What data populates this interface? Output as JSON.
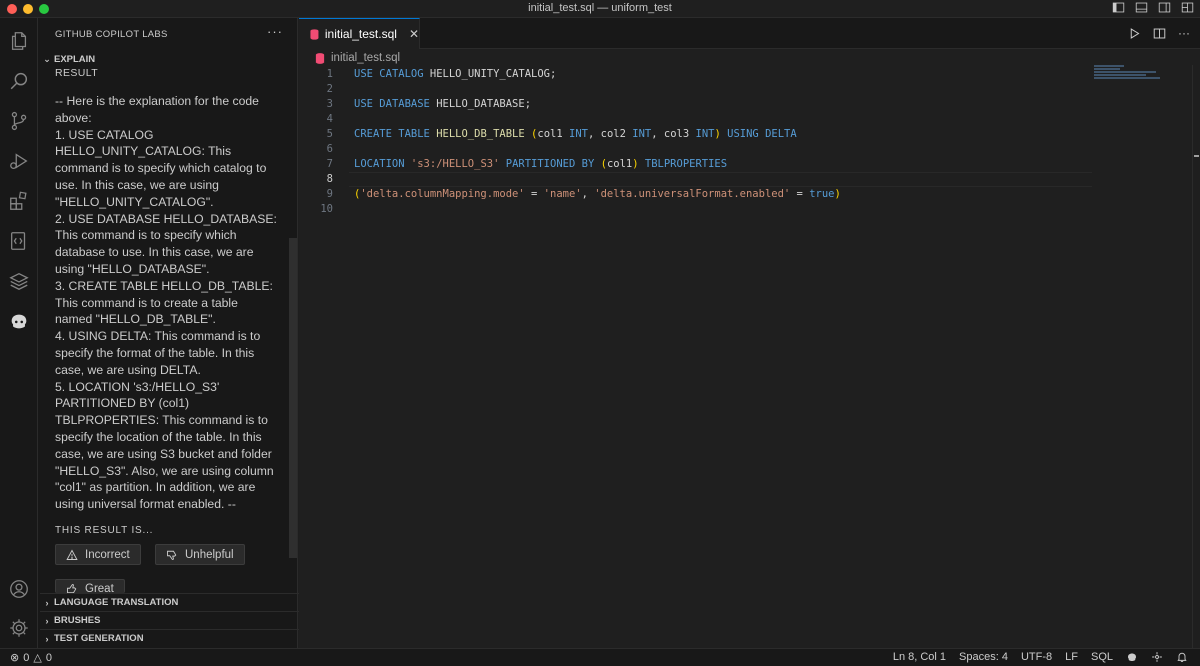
{
  "window": {
    "title": "initial_test.sql — uniform_test"
  },
  "activity_bar": {
    "items": [
      "explorer-icon",
      "search-icon",
      "source-control-icon",
      "run-debug-icon",
      "extensions-icon",
      "remote-explorer-icon",
      "layers-icon",
      "copilot-labs-icon"
    ],
    "bottom_items": [
      "account-icon",
      "manage-gear-icon"
    ]
  },
  "sidebar": {
    "title": "GITHUB COPILOT LABS",
    "explain_section": "EXPLAIN",
    "result_label": "RESULT",
    "explanation_text": "-- Here is the explanation for the code above:\n1. USE CATALOG HELLO_UNITY_CATALOG: This command is to specify which catalog to use. In this case, we are using \"HELLO_UNITY_CATALOG\".\n2. USE DATABASE HELLO_DATABASE: This command is to specify which database to use. In this case, we are using \"HELLO_DATABASE\".\n3. CREATE TABLE HELLO_DB_TABLE: This command is to create a table named \"HELLO_DB_TABLE\".\n4. USING DELTA: This command is to specify the format of the table. In this case, we are using DELTA.\n5. LOCATION 's3:/HELLO_S3' PARTITIONED BY (col1) TBLPROPERTIES: This command is to specify the location of the table. In this case, we are using S3 bucket and folder \"HELLO_S3\". Also, we are using column \"col1\" as partition. In addition, we are using universal format enabled. --",
    "feedback_prompt": "THIS RESULT IS...",
    "feedback_buttons": {
      "incorrect": "Incorrect",
      "unhelpful": "Unhelpful",
      "great": "Great"
    },
    "sections": [
      "LANGUAGE TRANSLATION",
      "BRUSHES",
      "TEST GENERATION"
    ]
  },
  "editor": {
    "tab_label": "initial_test.sql",
    "breadcrumb": "initial_test.sql",
    "active_line": 8,
    "lines": [
      {
        "n": "1",
        "text": "USE CATALOG HELLO_UNITY_CATALOG;"
      },
      {
        "n": "2",
        "text": ""
      },
      {
        "n": "3",
        "text": "USE DATABASE HELLO_DATABASE;"
      },
      {
        "n": "4",
        "text": ""
      },
      {
        "n": "5",
        "text": "CREATE TABLE HELLO_DB_TABLE (col1 INT, col2 INT, col3 INT) USING DELTA"
      },
      {
        "n": "6",
        "text": ""
      },
      {
        "n": "7",
        "text": "LOCATION 's3:/HELLO_S3' PARTITIONED BY (col1) TBLPROPERTIES"
      },
      {
        "n": "8",
        "text": ""
      },
      {
        "n": "9",
        "text": "('delta.columnMapping.mode' = 'name', 'delta.universalFormat.enabled' = true)"
      },
      {
        "n": "10",
        "text": ""
      }
    ]
  },
  "status_bar": {
    "errors": "0",
    "warnings": "0",
    "cursor": "Ln 8, Col 1",
    "spaces": "Spaces: 4",
    "encoding": "UTF-8",
    "eol": "LF",
    "language": "SQL"
  },
  "colors": {
    "accent": "#0078d4",
    "keyword": "#569cd6",
    "string": "#ce9178",
    "table_name": "#dcdcaa",
    "bracket": "#ffd700"
  }
}
